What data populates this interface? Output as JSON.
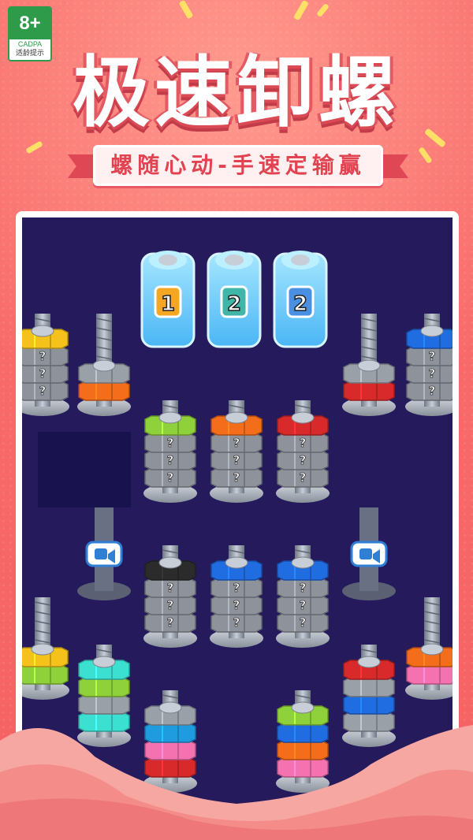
{
  "age_badge": {
    "rating": "8+",
    "org": "CADPA",
    "label": "适龄提示"
  },
  "header": {
    "title": "极速卸螺",
    "subtitle": "螺随心动-手速定输赢"
  },
  "theme": {
    "bg": "#f76a6a",
    "board_bg": "#241a5c",
    "title_shadow": "#d94a55",
    "subtitle_text": "#e24351"
  },
  "game": {
    "counters": [
      {
        "value": "1",
        "color": "#f5a623"
      },
      {
        "value": "2",
        "color": "#3fb6a8"
      },
      {
        "value": "2",
        "color": "#4a90e2"
      }
    ],
    "video_buttons": [
      {
        "icon": "video-camera-icon"
      },
      {
        "icon": "video-camera-icon"
      }
    ],
    "unknown_mark": "?",
    "bolts": [
      {
        "nuts": [
          "#f4c21a",
          "hidden",
          "hidden",
          "hidden"
        ]
      },
      {
        "nuts": [
          "#9aa0a8",
          "#f36d1a"
        ]
      },
      {
        "nuts": [
          "#9aa0a8",
          "#d82a2a"
        ]
      },
      {
        "nuts": [
          "#1f6de0",
          "hidden",
          "hidden",
          "hidden"
        ]
      },
      {
        "nuts": [
          "#8fd13a",
          "hidden",
          "hidden",
          "hidden"
        ]
      },
      {
        "nuts": [
          "#f36d1a",
          "hidden",
          "hidden",
          "hidden"
        ]
      },
      {
        "nuts": [
          "#d82a2a",
          "hidden",
          "hidden",
          "hidden"
        ]
      },
      {
        "nuts": [
          "#2b2b2b",
          "hidden",
          "hidden",
          "hidden"
        ]
      },
      {
        "nuts": [
          "#1f6de0",
          "hidden",
          "hidden",
          "hidden"
        ]
      },
      {
        "nuts": [
          "#1f6de0",
          "hidden",
          "hidden",
          "hidden"
        ]
      },
      {
        "nuts": [
          "#f4c21a",
          "#8fd13a"
        ]
      },
      {
        "nuts": [
          "#3ce0d0",
          "#8fd13a",
          "#9aa0a8",
          "#3ce0d0"
        ]
      },
      {
        "nuts": [
          "#9aa0a8",
          "#1f9be0",
          "#f572b0",
          "#d82a2a"
        ]
      },
      {
        "nuts": [
          "#8fd13a",
          "#1f6de0",
          "#f36d1a",
          "#f572b0"
        ]
      },
      {
        "nuts": [
          "#d82a2a",
          "#9aa0a8",
          "#1f6de0",
          "#9aa0a8"
        ]
      },
      {
        "nuts": [
          "#f36d1a",
          "#f572b0"
        ]
      }
    ]
  }
}
